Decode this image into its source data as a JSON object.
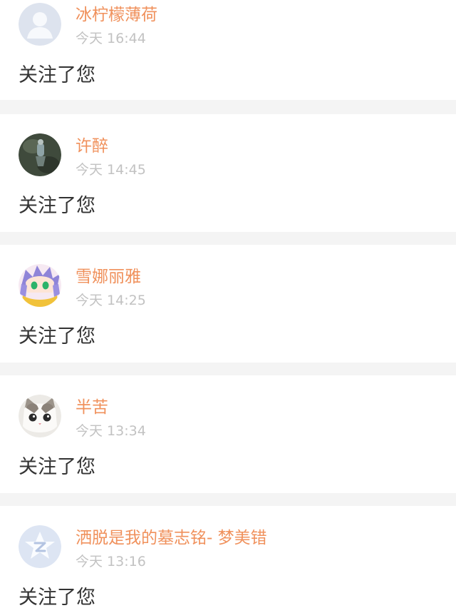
{
  "accent_color": "#f0915c",
  "notifications": [
    {
      "username": "冰柠檬薄荷",
      "time": "今天 16:44",
      "message": "关注了您",
      "avatar": "default-person-avatar"
    },
    {
      "username": "许醉",
      "time": "今天 14:45",
      "message": "关注了您",
      "avatar": "dark-photo-avatar"
    },
    {
      "username": "雪娜丽雅",
      "time": "今天 14:25",
      "message": "关注了您",
      "avatar": "anime-character-avatar"
    },
    {
      "username": "半苦",
      "time": "今天 13:34",
      "message": "关注了您",
      "avatar": "cat-photo-avatar"
    },
    {
      "username": "洒脱是我的墓志铭- 梦美错",
      "time": "今天 13:16",
      "message": "关注了您",
      "avatar": "default-z-avatar"
    }
  ]
}
